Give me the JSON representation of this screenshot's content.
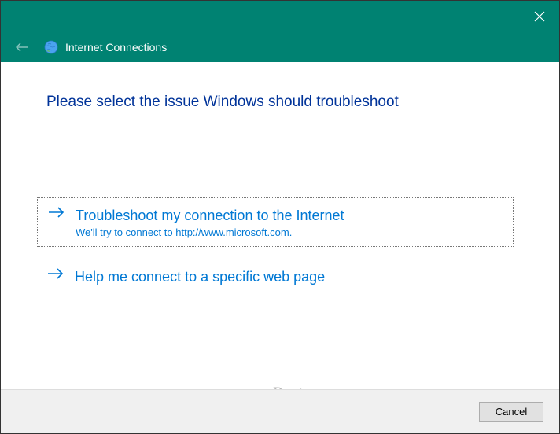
{
  "titlebar": {
    "close_icon": "close"
  },
  "header": {
    "title": "Internet Connections",
    "icon": "globe-icon"
  },
  "content": {
    "instruction": "Please select the issue Windows should troubleshoot",
    "options": [
      {
        "title": "Troubleshoot my connection to the Internet",
        "description": "We'll try to connect to http://www.microsoft.com.",
        "selected": true
      },
      {
        "title": "Help me connect to a specific web page",
        "description": "",
        "selected": false
      }
    ]
  },
  "footer": {
    "cancel_label": "Cancel"
  },
  "watermark": "groovyPost.com"
}
